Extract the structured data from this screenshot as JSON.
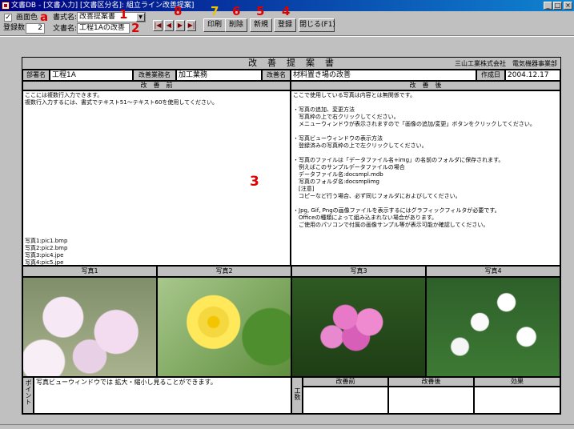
{
  "window": {
    "title": "文書DB - [文書入力]  [文書区分名]: 組立ライン改善提案]",
    "controls": [
      "_",
      "□",
      "×"
    ]
  },
  "toolbar": {
    "color_checkbox_label": "画面色",
    "color_checked": true,
    "record_count_label": "登録数",
    "record_count_value": "2",
    "format_label": "書式名:",
    "format_value": "改善提案書",
    "doc_name_label": "文書名:",
    "doc_name_value": "工程1Aの改善",
    "nav": [
      "|◀",
      "◀",
      "▶",
      "▶|"
    ],
    "buttons": [
      "印刷",
      "削除",
      "新規",
      "登録",
      "閉じる(F1)"
    ]
  },
  "annotations": {
    "a": "a",
    "one": "1",
    "two": "2",
    "eight": "8",
    "seven": "7",
    "six": "6",
    "five": "5",
    "four": "4",
    "three": "3"
  },
  "form": {
    "title": "改　善　提　案　書",
    "company": "三山工業株式会社　電気機器事業部",
    "dept_label": "部署名",
    "dept_value": "工程1A",
    "task_label": "改善業務名",
    "task_value": "加工業務",
    "name_label": "改善名",
    "name_value": "材料置き場の改善",
    "date_label": "作成日",
    "date_value": "2004.12.17",
    "before_header": "改　善　前",
    "after_header": "改　善　後",
    "before_text": "ここには複数行入力できます。\n複数行入力するには、書式でテキスト51～テキスト60を使用してください。",
    "before_photos": "写真1:pic1.bmp\n写真2:pic2.bmp\n写真3:pic4.jpe\n写真4:pic5.jpe",
    "after_text": "ここで使用している写真は内容とは無関係です。\n\n・写真の追加、変更方法\n　写真枠の上で右クリックしてください。\n　メニューウィンドウが表示されますので「画像の追加/変更」ボタンをクリックしてください。\n\n・写真ビューウィンドウの表示方法\n　登録済みの写真枠の上で左クリックしてください。\n\n・写真のファイルは「データファイル名+img」の名前のフォルダに保存されます。\n　例えばこのサンプルデータファイルの場合\n　データファイル名:docsmpl.mdb\n　写真のフォルダ名:docsmplimg\n　[注意]\n　コピーなど行う場合、必ず同じフォルダにおよびしてください。\n\n・Jpg, Gif, Pngの画像ファイルを表示するにはグラフィックフィルタが必要です。\n　Officeの種類によって組み込まれない場合があります。\n　ご使用のパソコンで付属の画像サンプル等が表示可能か確認してください。",
    "photo_labels": [
      "写真1",
      "写真2",
      "写真3",
      "写真4"
    ],
    "point_label": "ポイント",
    "point_text": "写真ビューウィンドウでは 拡大・縮小し見ることができます。",
    "kosu_label": "工数",
    "kosu_headers": [
      "改善前",
      "改善後",
      "効果"
    ]
  },
  "colors": {
    "window_bg": "#c0c0c0",
    "titlebar": "#000080",
    "annotation_red": "#e00000",
    "annotation_yellow": "#f2c200"
  }
}
